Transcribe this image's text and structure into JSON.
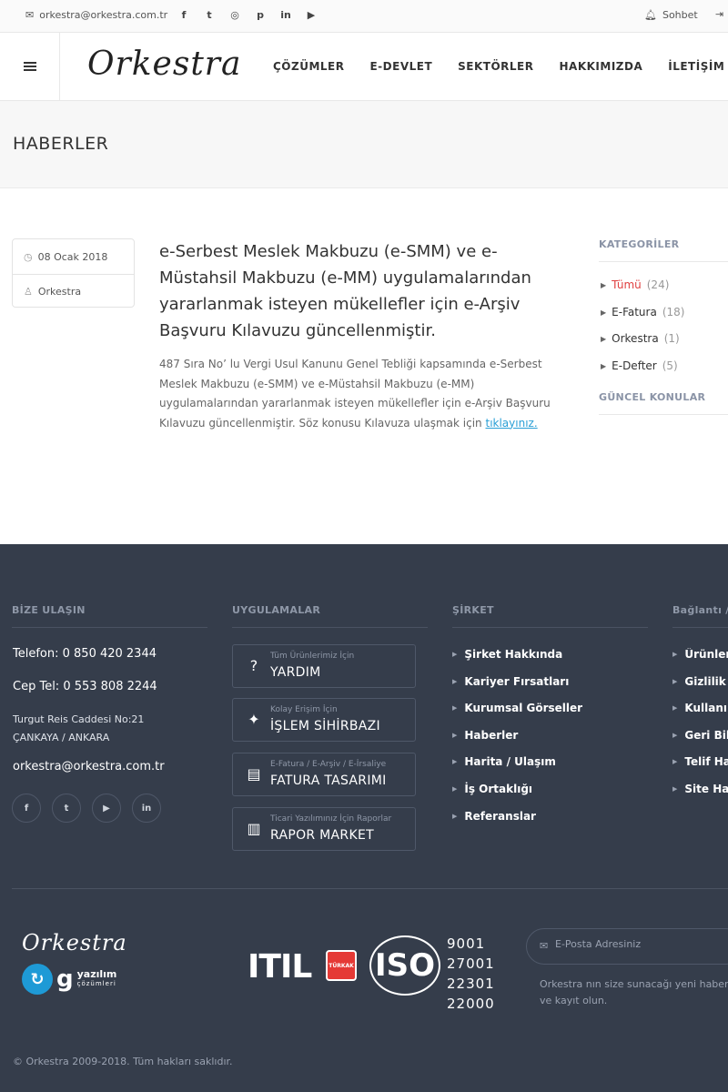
{
  "topbar": {
    "email": "orkestra@orkestra.com.tr",
    "socials": [
      "facebook-icon",
      "twitter-icon",
      "instagram-icon",
      "pinterest-icon",
      "linkedin-icon",
      "youtube-icon"
    ],
    "chat_label": "Sohbet"
  },
  "header": {
    "logo": "Orkestra",
    "nav": [
      "ÇÖZÜMLER",
      "E-DEVLET",
      "SEKTÖRLER",
      "HAKKIMIZDA",
      "İLETİŞİM"
    ]
  },
  "page": {
    "title": "HABERLER"
  },
  "article": {
    "date": "08 Ocak 2018",
    "author": "Orkestra",
    "title": "e-Serbest Meslek Makbuzu (e-SMM) ve e-Müstahsil Makbuzu (e-MM) uygulamalarından yararlanmak isteyen mükellefler için e-Arşiv Başvuru Kılavuzu güncellenmiştir.",
    "body": "487 Sıra No’ lu Vergi Usul Kanunu Genel Tebliği kapsamında e-Serbest Meslek Makbuzu (e-SMM) ve e-Müstahsil Makbuzu (e-MM) uygulamalarından yararlanmak isteyen mükellefler için e-Arşiv Başvuru Kılavuzu güncellenmiştir. Söz konusu Kılavuza ulaşmak için ",
    "link": "tıklayınız."
  },
  "sidebar": {
    "categories_title": "KATEGORİLER",
    "categories": [
      {
        "label": "Tümü",
        "count": "(24)"
      },
      {
        "label": "E-Fatura",
        "count": "(18)"
      },
      {
        "label": "Orkestra",
        "count": "(1)"
      },
      {
        "label": "E-Defter",
        "count": "(5)"
      }
    ],
    "topics_title": "GÜNCEL KONULAR"
  },
  "footer": {
    "contact_title": "BİZE ULAŞIN",
    "phone": "Telefon: 0 850 420 2344",
    "mobile": "Cep Tel: 0 553 808 2244",
    "address_line1": "Turgut Reis Caddesi No:21",
    "address_line2": "ÇANKAYA / ANKARA",
    "email": "orkestra@orkestra.com.tr",
    "apps_title": "UYGULAMALAR",
    "apps": [
      {
        "small": "Tüm Ürünlerimiz İçin",
        "big": "YARDIM",
        "icon": "help-icon"
      },
      {
        "small": "Kolay Erişim İçin",
        "big": "İŞLEM SİHİRBAZI",
        "icon": "magic-wand-icon"
      },
      {
        "small": "E-Fatura / E-Arşiv / E-İrsaliye",
        "big": "FATURA TASARIMI",
        "icon": "invoice-design-icon"
      },
      {
        "small": "Ticari Yazılımınız İçin Raporlar",
        "big": "RAPOR MARKET",
        "icon": "barcode-icon"
      }
    ],
    "company_title": "ŞİRKET",
    "company_links": [
      "Şirket Hakkında",
      "Kariyer Fırsatları",
      "Kurumsal Görseller",
      "Haberler",
      "Harita / Ulaşım",
      "İş Ortaklığı",
      "Referanslar"
    ],
    "links_title": "Bağlantı /",
    "links": [
      "Ürünler",
      "Gizlilik",
      "Kullanım",
      "Geri Bild",
      "Telif Hak",
      "Site Hari"
    ],
    "logo": "Orkestra",
    "gyazilim_letter": "g",
    "gyazilim_name": "yazılım",
    "gyazilim_sub": "çözümleri",
    "itil": "ITIL",
    "turkak": "TÜRKAK",
    "iso": "ISO",
    "iso_numbers": [
      "9001",
      "27001",
      "22301",
      "22000"
    ],
    "newsletter_placeholder": "E-Posta Adresiniz",
    "newsletter_text": "Orkestra nın size sunacağı yeni haber ve kayıt olun.",
    "copyright": "© Orkestra 2009-2018. Tüm hakları saklıdır."
  }
}
